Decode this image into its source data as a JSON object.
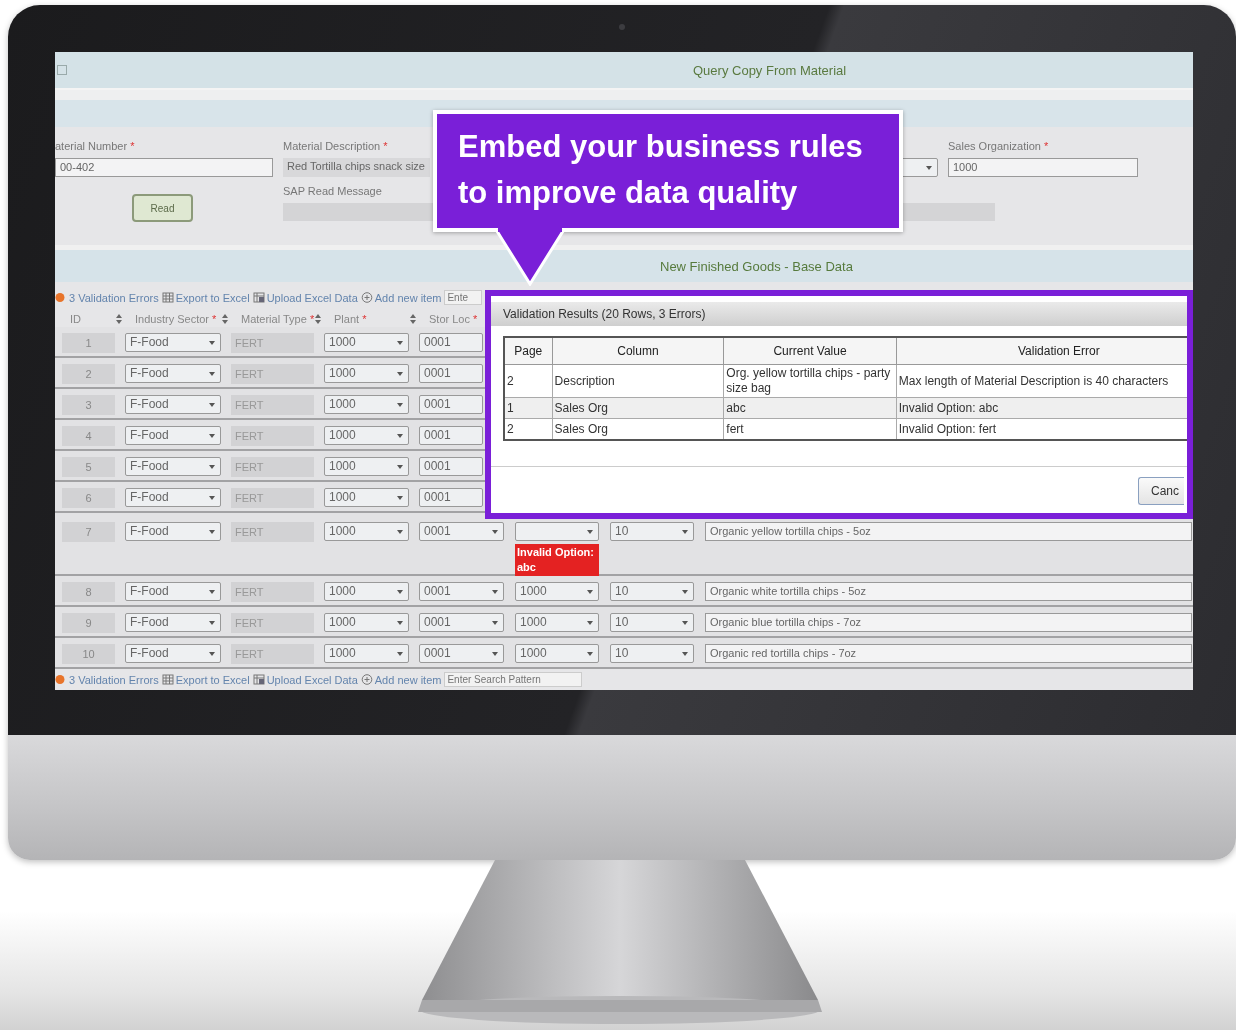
{
  "window": {
    "title": "Query Copy From Material",
    "select_all": {
      "checked": false
    }
  },
  "form": {
    "material_number": {
      "label": "aterial Number",
      "mark": "*",
      "value": "00-402"
    },
    "material_description": {
      "label": "Material Description",
      "mark": "*",
      "value": "Red Tortilla chips snack size"
    },
    "read_button": "Read",
    "sap_read_message": {
      "label": "SAP Read Message"
    },
    "sales_organization": {
      "label": "Sales Organization",
      "mark": "*",
      "value": "1000"
    }
  },
  "section_title": "New Finished Goods - Base Data",
  "toolbars": [
    {
      "errors": "3 Validation Errors",
      "export": "Export to Excel",
      "upload": "Upload Excel Data",
      "add": "Add new item",
      "placeholder": "Ente"
    },
    {
      "errors": "3 Validation Errors",
      "export": "Export to Excel",
      "upload": "Upload Excel Data",
      "add": "Add new item",
      "placeholder": "Enter Search Pattern"
    }
  ],
  "columns": [
    {
      "label": "ID"
    },
    {
      "label": "Industry Sector",
      "mark": "*"
    },
    {
      "label": "Material Type",
      "mark": "*"
    },
    {
      "label": "Plant",
      "mark": "*"
    },
    {
      "label": "Stor Loc",
      "mark": "*"
    }
  ],
  "rows": [
    {
      "id": "1",
      "industry_sector": "F-Food",
      "material_type": "FERT",
      "plant": "1000",
      "stor_loc": "0001"
    },
    {
      "id": "2",
      "industry_sector": "F-Food",
      "material_type": "FERT",
      "plant": "1000",
      "stor_loc": "0001"
    },
    {
      "id": "3",
      "industry_sector": "F-Food",
      "material_type": "FERT",
      "plant": "1000",
      "stor_loc": "0001"
    },
    {
      "id": "4",
      "industry_sector": "F-Food",
      "material_type": "FERT",
      "plant": "1000",
      "stor_loc": "0001"
    },
    {
      "id": "5",
      "industry_sector": "F-Food",
      "material_type": "FERT",
      "plant": "1000",
      "stor_loc": "0001"
    },
    {
      "id": "6",
      "industry_sector": "F-Food",
      "material_type": "FERT",
      "plant": "1000",
      "stor_loc": "0001"
    },
    {
      "id": "7",
      "industry_sector": "F-Food",
      "material_type": "FERT",
      "plant": "1000",
      "stor_loc": "0001",
      "column_6": {
        "error": "Invalid Option: abc"
      },
      "column_7": "10",
      "column_8": "Organic yellow tortilla chips - 5oz"
    },
    {
      "id": "8",
      "industry_sector": "F-Food",
      "material_type": "FERT",
      "plant": "1000",
      "stor_loc": "0001",
      "column_6": {
        "value": "1000"
      },
      "column_7": "10",
      "column_8": "Organic white tortilla chips - 5oz"
    },
    {
      "id": "9",
      "industry_sector": "F-Food",
      "material_type": "FERT",
      "plant": "1000",
      "stor_loc": "0001",
      "column_6": {
        "value": "1000"
      },
      "column_7": "10",
      "column_8": "Organic blue tortilla chips - 7oz"
    },
    {
      "id": "10",
      "industry_sector": "F-Food",
      "material_type": "FERT",
      "plant": "1000",
      "stor_loc": "0001",
      "column_6": {
        "value": "1000"
      },
      "column_7": "10",
      "column_8": "Organic red tortilla chips - 7oz"
    }
  ],
  "dialog": {
    "title": "Validation Results (20 Rows, 3 Errors)",
    "columns": [
      "Page",
      "Column",
      "Current Value",
      "Validation Error"
    ],
    "rows": [
      [
        "2",
        "Description",
        "Org. yellow tortilla chips - party size bag",
        "Max length of Material Description is 40 characters"
      ],
      [
        "1",
        "Sales Org",
        "abc",
        "Invalid Option: abc"
      ],
      [
        "2",
        "Sales Org",
        "fert",
        "Invalid Option: fert"
      ]
    ],
    "button": "Canc"
  },
  "callout": {
    "text": "Embed your business rules to improve data quality"
  }
}
